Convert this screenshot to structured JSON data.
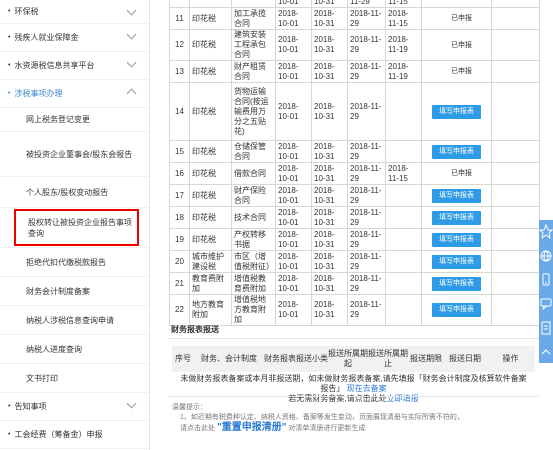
{
  "sidebar": {
    "top_items": [
      {
        "label": "环保税",
        "bullet": "•"
      },
      {
        "label": "残疾人就业保障金",
        "bullet": "•"
      },
      {
        "label": "水资源税信息共享平台",
        "bullet": "•"
      }
    ],
    "active_group": {
      "label": "涉税事项办理",
      "bullet": "•"
    },
    "sub_items": [
      {
        "label": "网上税务登记变更"
      },
      {
        "label": "被投资企业董事会/股东会报告"
      },
      {
        "label": "个人股东/股权变动报告"
      },
      {
        "label": "股权转让被投资企业报告事项查询"
      },
      {
        "label": "拒绝代扣代缴税款报告"
      },
      {
        "label": "财务会计制度备案"
      },
      {
        "label": "纳税人涉税信息查询申请"
      },
      {
        "label": "纳税人进度查询"
      },
      {
        "label": "文书打印"
      }
    ],
    "bottom_items": [
      {
        "label": "告知事项",
        "bullet": "•"
      },
      {
        "label": "工会经费（筹备金）申报",
        "bullet": "•"
      }
    ]
  },
  "tax_table": {
    "top_partial": {
      "c1": "10-01",
      "c2": "10-31",
      "c3": "11-29",
      "c4": "11-15"
    },
    "rows": [
      {
        "num": "11",
        "tax": "印花税",
        "item": "加工承揽合同",
        "d1": "2018-10-01",
        "d2": "2018-10-31",
        "d3": "2018-11-29",
        "d4": "2018-11-15",
        "action": "已申报",
        "action_type": "status"
      },
      {
        "num": "12",
        "tax": "印花税",
        "item": "建筑安装工程承包合同",
        "d1": "2018-10-01",
        "d2": "2018-10-31",
        "d3": "2018-11-29",
        "d4": "2018-11-19",
        "action": "已申报",
        "action_type": "status"
      },
      {
        "num": "13",
        "tax": "印花税",
        "item": "财产租赁合同",
        "d1": "2018-10-01",
        "d2": "2018-10-31",
        "d3": "2018-11-29",
        "d4": "2018-11-19",
        "action": "已申报",
        "action_type": "status"
      },
      {
        "num": "14",
        "tax": "印花税",
        "item": "货物运输合同(按运输费用万分之五贴花)",
        "d1": "2018-10-01",
        "d2": "2018-10-31",
        "d3": "2018-11-29",
        "d4": "",
        "action": "填写申报表",
        "action_type": "button"
      },
      {
        "num": "15",
        "tax": "印花税",
        "item": "仓储保管合同",
        "d1": "2018-10-01",
        "d2": "2018-10-31",
        "d3": "2018-11-29",
        "d4": "",
        "action": "填写申报表",
        "action_type": "button"
      },
      {
        "num": "16",
        "tax": "印花税",
        "item": "借款合同",
        "d1": "2018-10-01",
        "d2": "2018-10-31",
        "d3": "2018-11-29",
        "d4": "2018-11-15",
        "action": "已申报",
        "action_type": "status"
      },
      {
        "num": "17",
        "tax": "印花税",
        "item": "财产保险合同",
        "d1": "2018-10-01",
        "d2": "2018-10-31",
        "d3": "2018-11-29",
        "d4": "",
        "action": "填写申报表",
        "action_type": "button"
      },
      {
        "num": "18",
        "tax": "印花税",
        "item": "技术合同",
        "d1": "2018-10-01",
        "d2": "2018-10-31",
        "d3": "2018-11-29",
        "d4": "",
        "action": "填写申报表",
        "action_type": "button"
      },
      {
        "num": "19",
        "tax": "印花税",
        "item": "产权转移书据",
        "d1": "2018-10-01",
        "d2": "2018-10-31",
        "d3": "2018-11-29",
        "d4": "",
        "action": "填写申报表",
        "action_type": "button"
      },
      {
        "num": "20",
        "tax": "城市维护建设税",
        "item": "市区（增值税附征）",
        "d1": "2018-10-01",
        "d2": "2018-10-31",
        "d3": "2018-11-29",
        "d4": "",
        "action": "填写申报表",
        "action_type": "button"
      },
      {
        "num": "21",
        "tax": "教育费附加",
        "item": "增值税教育费附加",
        "d1": "2018-10-01",
        "d2": "2018-10-31",
        "d3": "2018-11-29",
        "d4": "",
        "action": "填写申报表",
        "action_type": "button"
      },
      {
        "num": "22",
        "tax": "地方教育附加",
        "item": "增值税地方教育附加",
        "d1": "2018-10-01",
        "d2": "2018-10-31",
        "d3": "2018-11-29",
        "d4": "",
        "action": "填写申报表",
        "action_type": "button"
      }
    ]
  },
  "finance": {
    "title": "财务报表报送",
    "headers": [
      "序号",
      "财务、会计制度",
      "财务报表报送小类",
      "报送所属期起",
      "报送所属期止",
      "报送期限",
      "报送日期",
      "操作"
    ],
    "notice_1": "未做财务报表备案或本月非报送期，如未做财务报表备案,请先填报「财务会计制度及核算软件备案报告」",
    "notice_1_link": "现在去备案",
    "notice_2": "若无需财务备案,请点击此处",
    "notice_2_link": "立即填报"
  },
  "tips": {
    "title": "温馨提示：",
    "line1": "1、如近期有税费种认定、纳税人资格、备案等发生变动，页面展现清册与实际所需不符的，",
    "line2_a": "请点击此处",
    "line2_em": "\"重置申报清册\"",
    "line2_b": "对清单清册进行更新生成"
  },
  "float_toolbar": {
    "icons": [
      "star-icon",
      "globe-icon",
      "phone-icon",
      "chat-icon",
      "document-icon",
      "chevron-up-icon"
    ]
  }
}
